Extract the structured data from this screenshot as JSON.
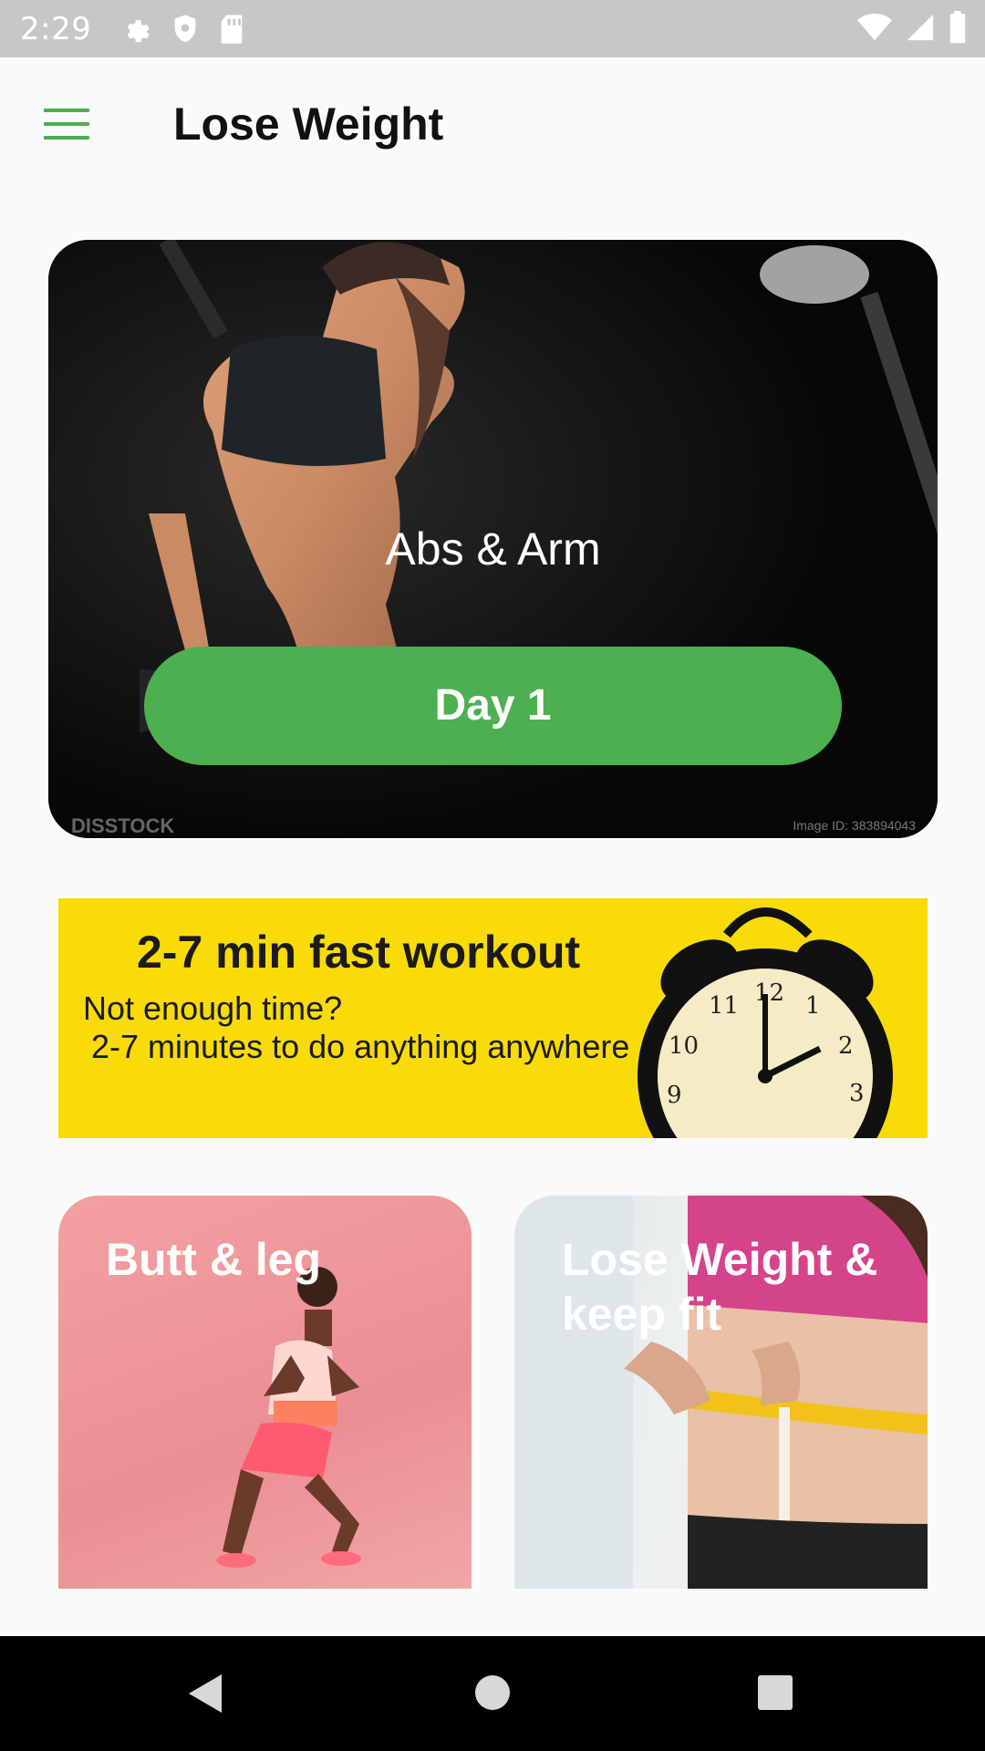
{
  "status_bar": {
    "time": "2:29",
    "icons": [
      "settings-icon",
      "shield-icon",
      "sd-card-icon",
      "wifi-icon",
      "signal-icon",
      "battery-icon"
    ]
  },
  "app_bar": {
    "menu_icon": "hamburger-menu-icon",
    "title": "Lose Weight",
    "accent_color": "#4caf50"
  },
  "hero_card": {
    "title": "Abs & Arm",
    "button_label": "Day 1",
    "watermark": "DISSTOCK",
    "image_id": "Image ID: 383894043"
  },
  "banner": {
    "title": "2-7 min fast workout",
    "line1": "Not enough time?",
    "line2": "2-7 minutes to do anything anywhere",
    "background_color": "#f9db08",
    "clock_icon": "alarm-clock-icon"
  },
  "cards": [
    {
      "label": "Butt & leg"
    },
    {
      "label": "Lose Weight & keep fit"
    }
  ],
  "nav_bar": {
    "back_icon": "back-triangle-icon",
    "home_icon": "home-circle-icon",
    "recents_icon": "recents-square-icon"
  }
}
